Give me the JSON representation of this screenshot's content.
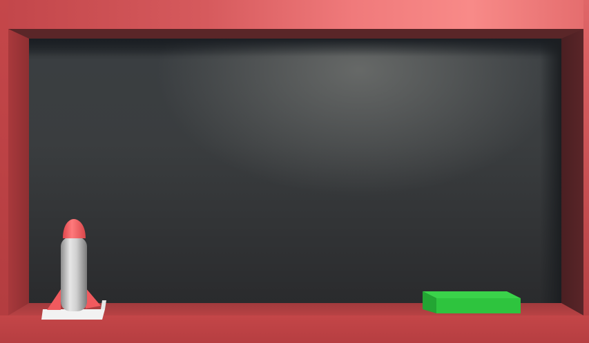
{
  "scene": {
    "name": "rocket-landing-box",
    "colors": {
      "frame": "#b94043",
      "backdrop": "#3a3d3f",
      "rocket_body": "#c8c8c8",
      "rocket_nose": "#f05a5e",
      "launch_pad": "#f2f2f2",
      "goal_block": "#2ec43e"
    },
    "objects": {
      "rocket": "rocket-icon",
      "launch_pad": "launch-pad",
      "goal": "green-landing-block"
    }
  }
}
